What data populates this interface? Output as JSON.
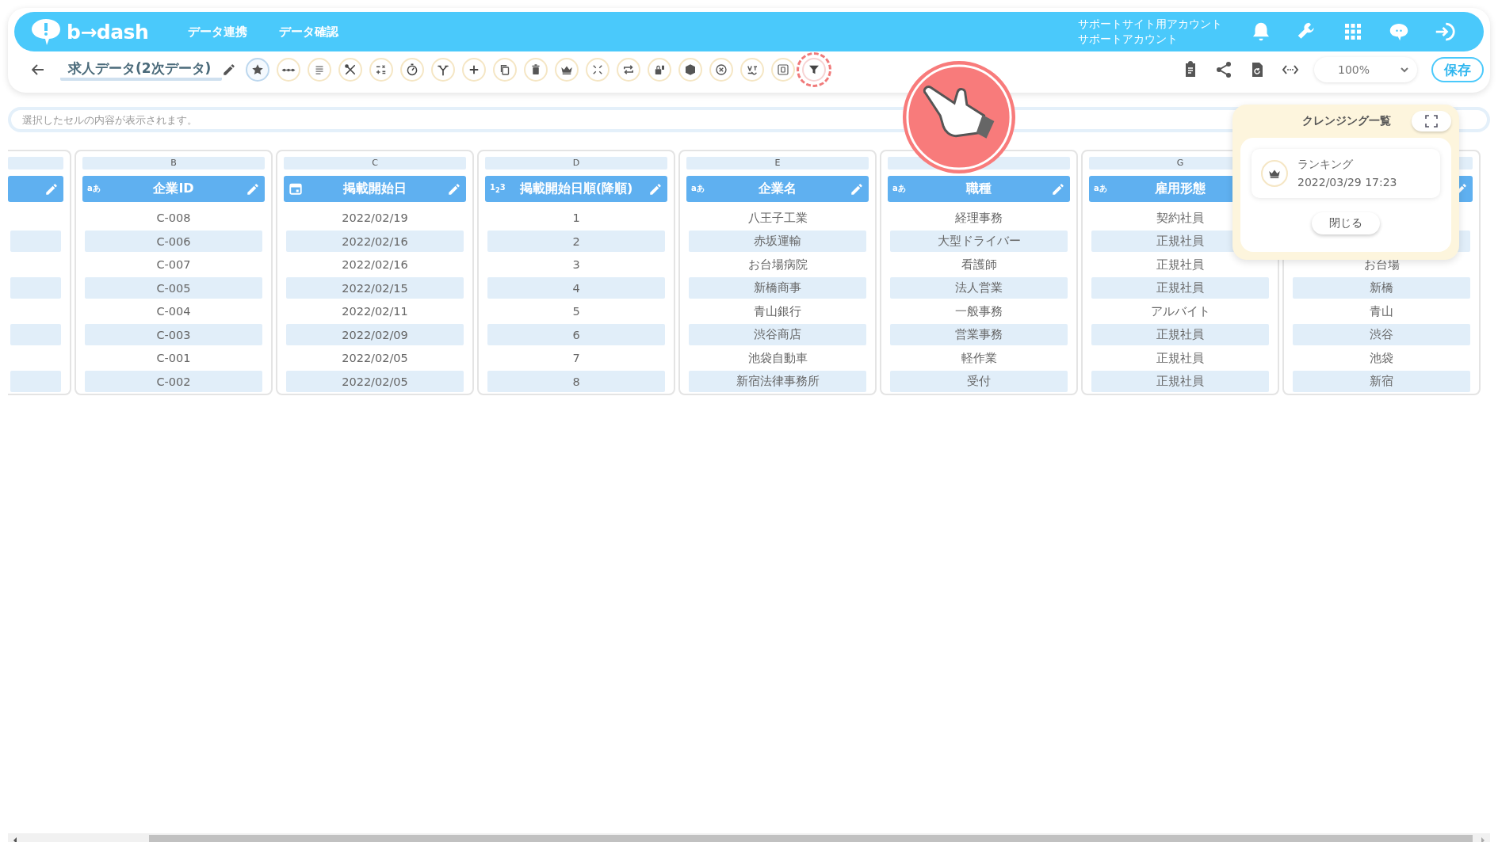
{
  "header": {
    "logo": "b→dash",
    "nav": [
      "データ連携",
      "データ確認"
    ],
    "account": [
      "サポートサイト用アカウント",
      "サポートアカウント"
    ],
    "icons": [
      {
        "kind": "bell"
      },
      {
        "kind": "wrench"
      },
      {
        "kind": "grid"
      },
      {
        "kind": "chat"
      },
      {
        "kind": "logout"
      }
    ]
  },
  "toolbar": {
    "title": "求人データ(2次データ)",
    "tools": [
      {
        "kind": "star",
        "selected": true,
        "highlighted": false
      },
      {
        "kind": "dots",
        "selected": false,
        "highlighted": false
      },
      {
        "kind": "lines",
        "selected": false,
        "highlighted": false
      },
      {
        "kind": "tools",
        "selected": false,
        "highlighted": false
      },
      {
        "kind": "calc",
        "selected": false,
        "highlighted": false
      },
      {
        "kind": "timer",
        "selected": false,
        "highlighted": false
      },
      {
        "kind": "branch",
        "selected": false,
        "highlighted": false
      },
      {
        "kind": "plus",
        "selected": false,
        "highlighted": false
      },
      {
        "kind": "copy",
        "selected": false,
        "highlighted": false
      },
      {
        "kind": "trash",
        "selected": false,
        "highlighted": false
      },
      {
        "kind": "crown",
        "selected": false,
        "highlighted": false
      },
      {
        "kind": "compress",
        "selected": false,
        "highlighted": false
      },
      {
        "kind": "repeat",
        "selected": false,
        "highlighted": false
      },
      {
        "kind": "lock",
        "selected": false,
        "highlighted": false
      },
      {
        "kind": "box",
        "selected": false,
        "highlighted": false
      },
      {
        "kind": "xcircle",
        "selected": false,
        "highlighted": false
      },
      {
        "kind": "swap",
        "selected": false,
        "highlighted": false
      },
      {
        "kind": "zero",
        "selected": false,
        "highlighted": false
      },
      {
        "kind": "filter",
        "selected": false,
        "highlighted": true
      }
    ],
    "right_icons": [
      {
        "kind": "clipboard"
      },
      {
        "kind": "share"
      },
      {
        "kind": "file"
      },
      {
        "kind": "code"
      }
    ],
    "zoom": "100%",
    "save": "保存"
  },
  "cell_field": {
    "placeholder": "選択したセルの内容が表示されます。"
  },
  "columns": [
    {
      "cut": true
    },
    {
      "cut": false,
      "letter": "B",
      "kind": "text",
      "type_label": "aあ",
      "name": "企業ID",
      "cells": [
        "C-008",
        "C-006",
        "C-007",
        "C-005",
        "C-004",
        "C-003",
        "C-001",
        "C-002"
      ]
    },
    {
      "cut": false,
      "letter": "C",
      "kind": "date",
      "name": "掲載開始日",
      "cells": [
        "2022/02/19",
        "2022/02/16",
        "2022/02/16",
        "2022/02/15",
        "2022/02/11",
        "2022/02/09",
        "2022/02/05",
        "2022/02/05"
      ]
    },
    {
      "cut": false,
      "letter": "D",
      "kind": "number",
      "type_label": "1$_{2}$3",
      "name": "掲載開始日順(降順)",
      "cells": [
        "1",
        "2",
        "3",
        "4",
        "5",
        "6",
        "7",
        "8"
      ]
    },
    {
      "cut": false,
      "letter": "E",
      "kind": "text",
      "type_label": "aあ",
      "name": "企業名",
      "cells": [
        "八王子工業",
        "赤坂運輸",
        "お台場病院",
        "新橋商事",
        "青山銀行",
        "渋谷商店",
        "池袋自動車",
        "新宿法律事務所"
      ]
    },
    {
      "cut": false,
      "kind": "text",
      "type_label": "aあ",
      "name": "職種",
      "cells": [
        "経理事務",
        "大型ドライバー",
        "看護師",
        "法人営業",
        "一般事務",
        "営業事務",
        "軽作業",
        "受付"
      ]
    },
    {
      "cut": false,
      "letter": "G",
      "kind": "text",
      "type_label": "aあ",
      "name": "雇用形態",
      "cells": [
        "契約社員",
        "正規社員",
        "正規社員",
        "正規社員",
        "アルバイト",
        "正規社員",
        "正規社員",
        "正規社員"
      ]
    },
    {
      "cut": false,
      "cells": [
        "お台場",
        "新橋",
        "青山",
        "渋谷",
        "池袋",
        "新宿"
      ]
    }
  ],
  "popup": {
    "title": "クレンジング一覧",
    "item": {
      "name": "ランキング",
      "date": "2022/03/29 17:23"
    },
    "close": "閉じる"
  }
}
